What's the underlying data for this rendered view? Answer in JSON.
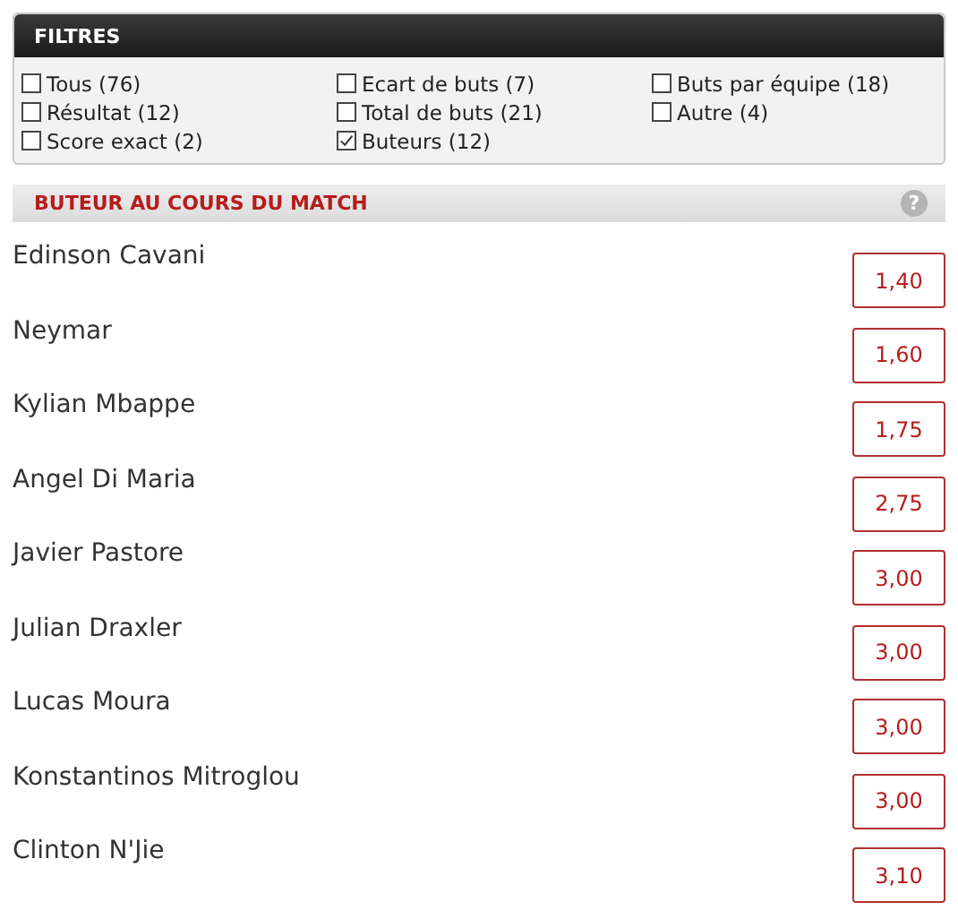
{
  "filters": {
    "title": "FILTRES",
    "items": [
      {
        "label": "Tous (76)",
        "checked": false
      },
      {
        "label": "Ecart de buts (7)",
        "checked": false
      },
      {
        "label": "Buts par équipe (18)",
        "checked": false
      },
      {
        "label": "Résultat (12)",
        "checked": false
      },
      {
        "label": "Total de buts (21)",
        "checked": false
      },
      {
        "label": "Autre (4)",
        "checked": false
      },
      {
        "label": "Score exact (2)",
        "checked": false
      },
      {
        "label": "Buteurs (12)",
        "checked": true
      }
    ]
  },
  "market": {
    "title": "BUTEUR AU COURS DU MATCH",
    "help_icon": "?",
    "players": [
      {
        "name": "Edinson Cavani",
        "odds": "1,40"
      },
      {
        "name": "Neymar",
        "odds": "1,60"
      },
      {
        "name": "Kylian Mbappe",
        "odds": "1,75"
      },
      {
        "name": "Angel Di Maria",
        "odds": "2,75"
      },
      {
        "name": "Javier Pastore",
        "odds": "3,00"
      },
      {
        "name": "Julian Draxler",
        "odds": "3,00"
      },
      {
        "name": "Lucas Moura",
        "odds": "3,00"
      },
      {
        "name": "Konstantinos Mitroglou",
        "odds": "3,00"
      },
      {
        "name": "Clinton N'Jie",
        "odds": "3,10"
      }
    ]
  }
}
